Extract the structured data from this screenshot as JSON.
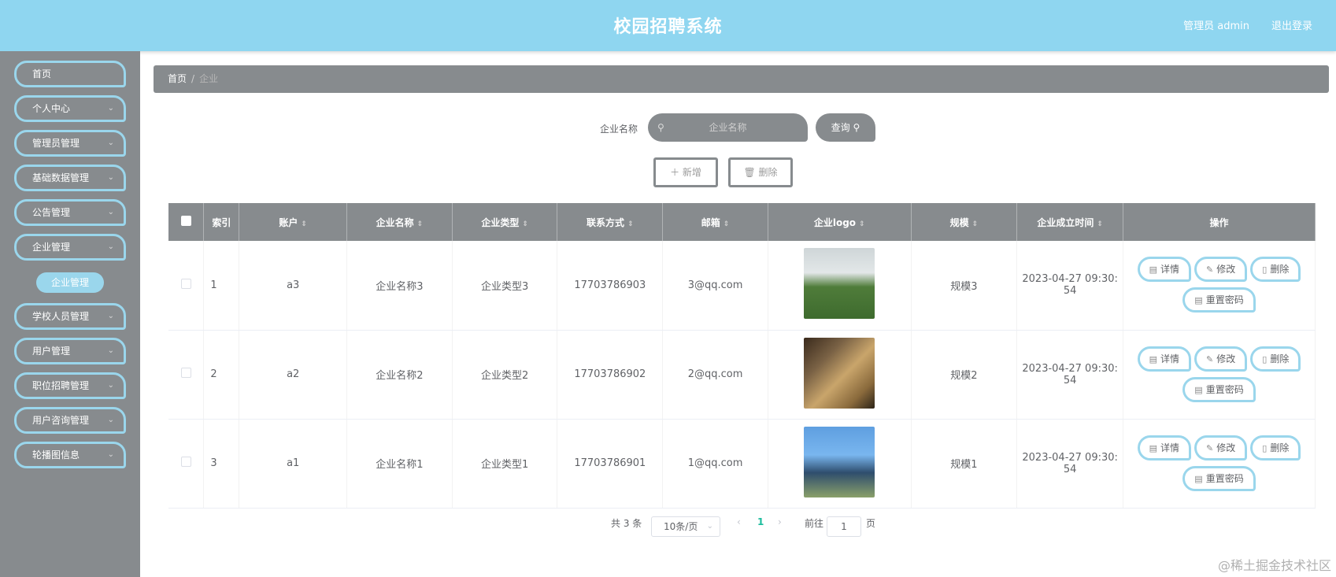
{
  "header": {
    "title": "校园招聘系统",
    "admin_label": "管理员 admin",
    "logout": "退出登录"
  },
  "sidebar": {
    "items": [
      {
        "label": "首页",
        "has_arrow": false
      },
      {
        "label": "个人中心",
        "has_arrow": true
      },
      {
        "label": "管理员管理",
        "has_arrow": true
      },
      {
        "label": "基础数据管理",
        "has_arrow": true
      },
      {
        "label": "公告管理",
        "has_arrow": true
      },
      {
        "label": "企业管理",
        "has_arrow": true
      },
      {
        "label": "学校人员管理",
        "has_arrow": true
      },
      {
        "label": "用户管理",
        "has_arrow": true
      },
      {
        "label": "职位招聘管理",
        "has_arrow": true
      },
      {
        "label": "用户咨询管理",
        "has_arrow": true
      },
      {
        "label": "轮播图信息",
        "has_arrow": true
      }
    ],
    "subitem": "企业管理"
  },
  "breadcrumb": {
    "home": "首页",
    "sep": "/",
    "current": "企业"
  },
  "search": {
    "label": "企业名称",
    "placeholder": "企业名称",
    "query_button": "查询"
  },
  "actions": {
    "add": "新增",
    "delete": "删除"
  },
  "table": {
    "headers": [
      "索引",
      "账户",
      "企业名称",
      "企业类型",
      "联系方式",
      "邮箱",
      "企业logo",
      "规模",
      "企业成立时间",
      "操作"
    ],
    "rows": [
      {
        "index": "1",
        "account": "a3",
        "name": "企业名称3",
        "type": "企业类型3",
        "phone": "17703786903",
        "email": "3@qq.com",
        "scale": "规模3",
        "time_line1": "2023-04-27 09:30:",
        "time_line2": "54"
      },
      {
        "index": "2",
        "account": "a2",
        "name": "企业名称2",
        "type": "企业类型2",
        "phone": "17703786902",
        "email": "2@qq.com",
        "scale": "规模2",
        "time_line1": "2023-04-27 09:30:",
        "time_line2": "54"
      },
      {
        "index": "3",
        "account": "a1",
        "name": "企业名称1",
        "type": "企业类型1",
        "phone": "17703786901",
        "email": "1@qq.com",
        "scale": "规模1",
        "time_line1": "2023-04-27 09:30:",
        "time_line2": "54"
      }
    ],
    "row_buttons": {
      "detail": "详情",
      "edit": "修改",
      "delete": "删除",
      "reset": "重置密码"
    }
  },
  "pagination": {
    "total": "共 3 条",
    "page_size": "10条/页",
    "prev": "‹",
    "current_page": "1",
    "next": "›",
    "goto_label": "前往",
    "goto_value": "1",
    "page_suffix": "页"
  },
  "watermark": "@稀土掘金技术社区",
  "colors": {
    "header": "#8fd6f0",
    "sidebar": "#878b8e",
    "accent_border": "#9ad6ec",
    "page_active": "#1abc9c"
  }
}
